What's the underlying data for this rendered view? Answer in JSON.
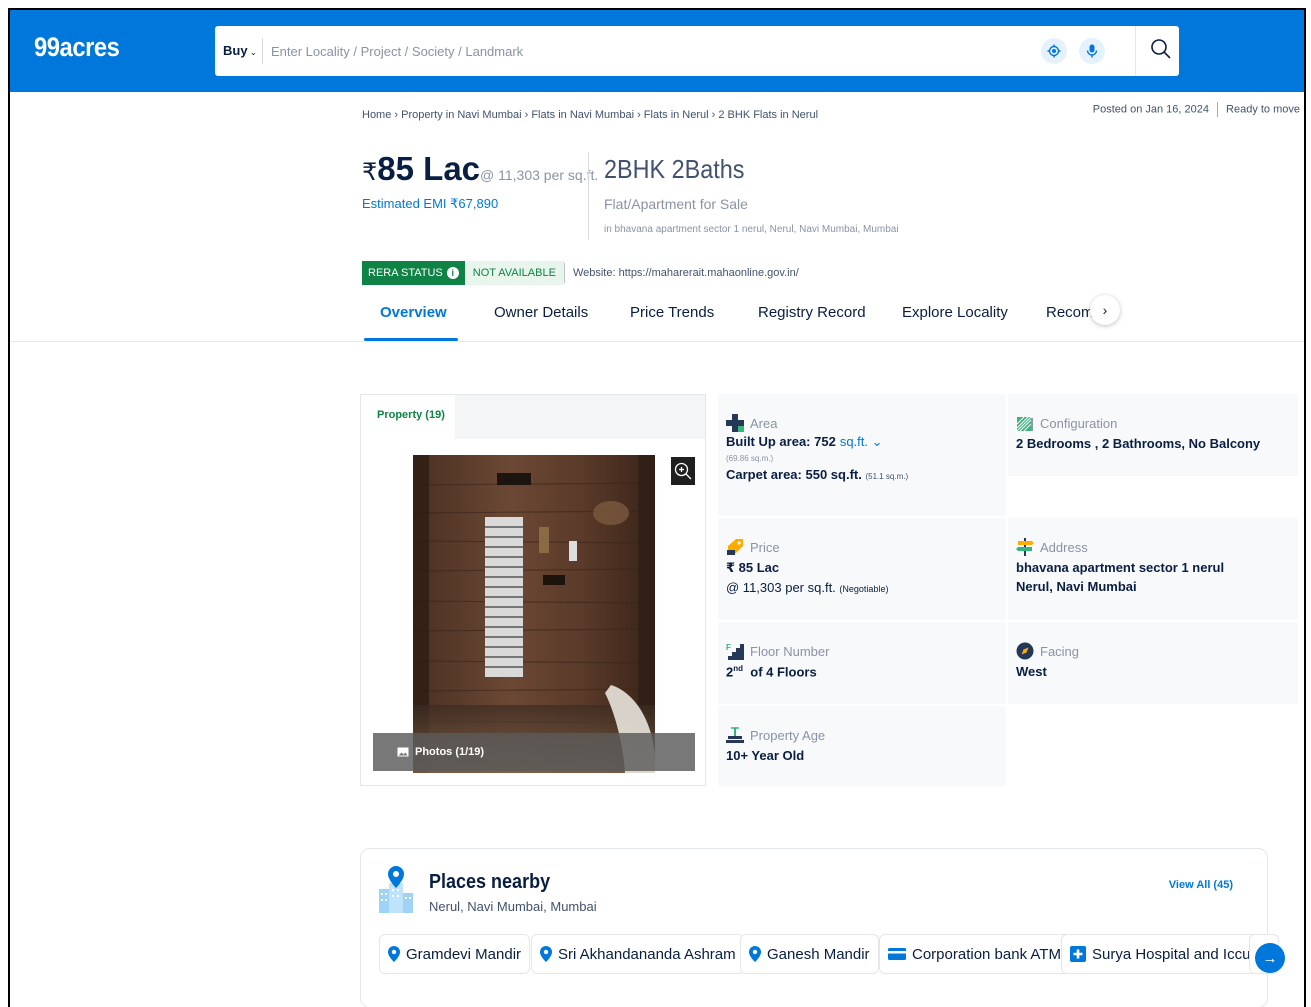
{
  "header": {
    "logo": "99acres",
    "search": {
      "buy_label": "Buy",
      "placeholder": "Enter Locality / Project / Society / Landmark"
    }
  },
  "breadcrumb": "Home › Property in Navi Mumbai › Flats in Navi Mumbai › Flats in Nerul › 2 BHK Flats in Nerul",
  "post_info": {
    "posted": "Posted on Jan 16, 2024",
    "status": "Ready to move"
  },
  "price": {
    "currency": "₹",
    "amount": "85 Lac",
    "per_sqft": "@ 11,303 per sq.ft.",
    "emi": "Estimated EMI ₹67,890"
  },
  "property": {
    "title": "2BHK 2Baths",
    "type": "Flat/Apartment for Sale",
    "location": "in bhavana apartment sector 1 nerul, Nerul, Navi Mumbai, Mumbai"
  },
  "rera": {
    "badge": "RERA STATUS",
    "status": "NOT AVAILABLE",
    "website": "Website: https://maharerait.mahaonline.gov.in/"
  },
  "tabs": [
    "Overview",
    "Owner Details",
    "Price Trends",
    "Registry Record",
    "Explore Locality",
    "Recomr"
  ],
  "gallery": {
    "tab": "Property (19)",
    "photos": "Photos (1/19)"
  },
  "details": {
    "area": {
      "label": "Area",
      "builtup": "Built Up area: 752",
      "unit": "sq.ft.",
      "builtup_sqm": "(69.86 sq.m.)",
      "carpet": "Carpet area: 550 sq.ft.",
      "carpet_sqm": "(51.1 sq.m.)"
    },
    "configuration": {
      "label": "Configuration",
      "value": "2 Bedrooms , 2 Bathrooms, No Balcony"
    },
    "price": {
      "label": "Price",
      "value": "₹ 85 Lac",
      "per_sqft": "@ 11,303 per sq.ft.",
      "negotiable": "(Negotiable)"
    },
    "address": {
      "label": "Address",
      "line1": "bhavana apartment sector 1 nerul",
      "line2": "Nerul, Navi Mumbai"
    },
    "floor": {
      "label": "Floor Number",
      "num": "2",
      "suffix": "nd",
      "of": "of 4 Floors"
    },
    "facing": {
      "label": "Facing",
      "value": "West"
    },
    "age": {
      "label": "Property Age",
      "value": "10+ Year Old"
    }
  },
  "places": {
    "title": "Places nearby",
    "subtitle": "Nerul, Navi Mumbai, Mumbai",
    "view_all": "View All (45)",
    "items": [
      {
        "name": "Gramdevi Mandir",
        "icon": "location-pin-icon"
      },
      {
        "name": "Sri Akhandananda Ashram",
        "icon": "location-pin-icon"
      },
      {
        "name": "Ganesh Mandir",
        "icon": "location-pin-icon"
      },
      {
        "name": "Corporation bank ATM",
        "icon": "atm-card-icon"
      },
      {
        "name": "Surya Hospital and Iccu",
        "icon": "hospital-icon"
      }
    ]
  },
  "colors": {
    "brand_blue": "#0078DB",
    "rera_green": "#0E8345"
  }
}
